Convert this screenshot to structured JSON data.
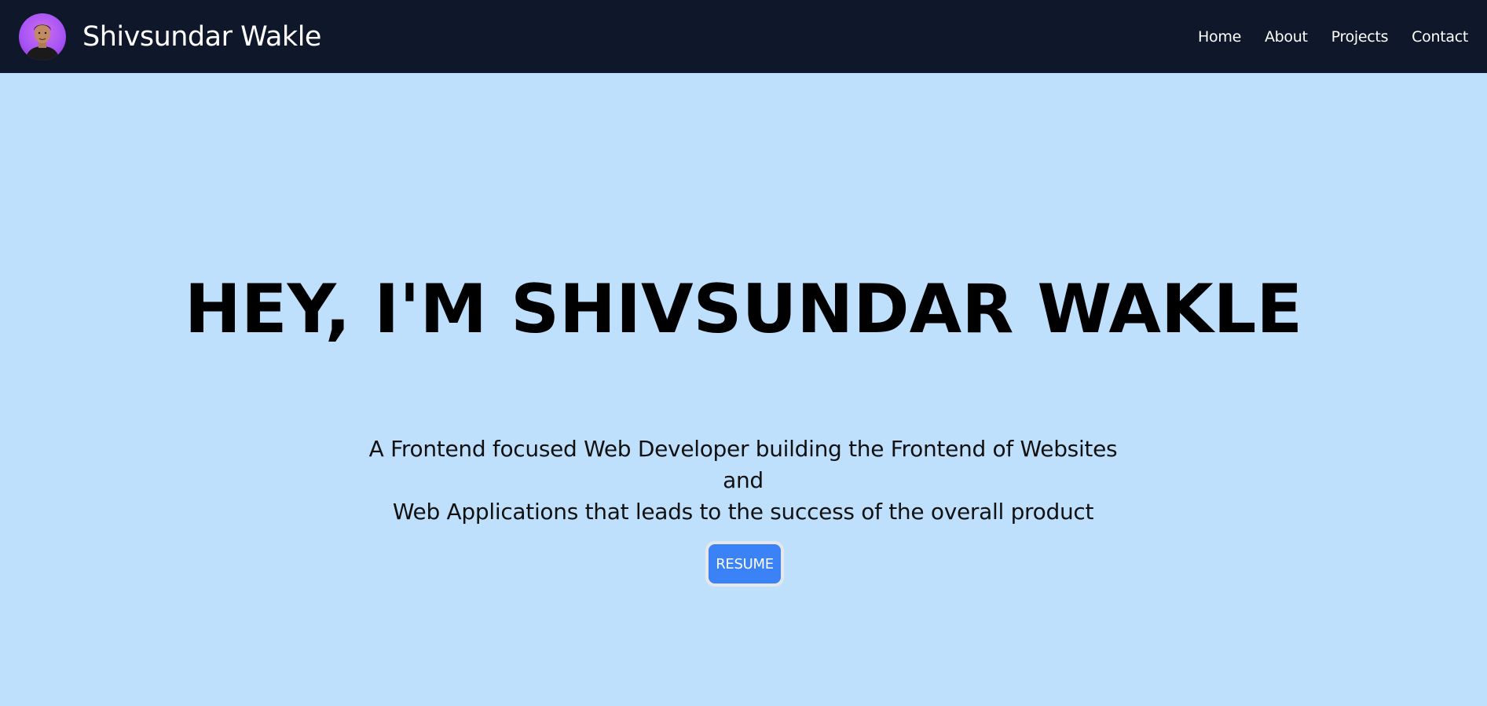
{
  "nav": {
    "brand_name": "Shivsundar Wakle",
    "links": [
      "Home",
      "About",
      "Projects",
      "Contact"
    ]
  },
  "hero": {
    "title": "HEY, I'M SHIVSUNDAR WAKLE",
    "subtitle_line1": "A Frontend focused Web Developer building the Frontend of Websites and",
    "subtitle_line2": "Web Applications that leads to the success of the overall product",
    "resume_label": "RESUME"
  },
  "colors": {
    "navbar_bg": "#0f172a",
    "hero_bg": "#bfe0fc",
    "button_bg": "#3b82f6",
    "avatar_accent": "#a855f7"
  },
  "icons": {
    "avatar": "profile-photo-avatar"
  }
}
